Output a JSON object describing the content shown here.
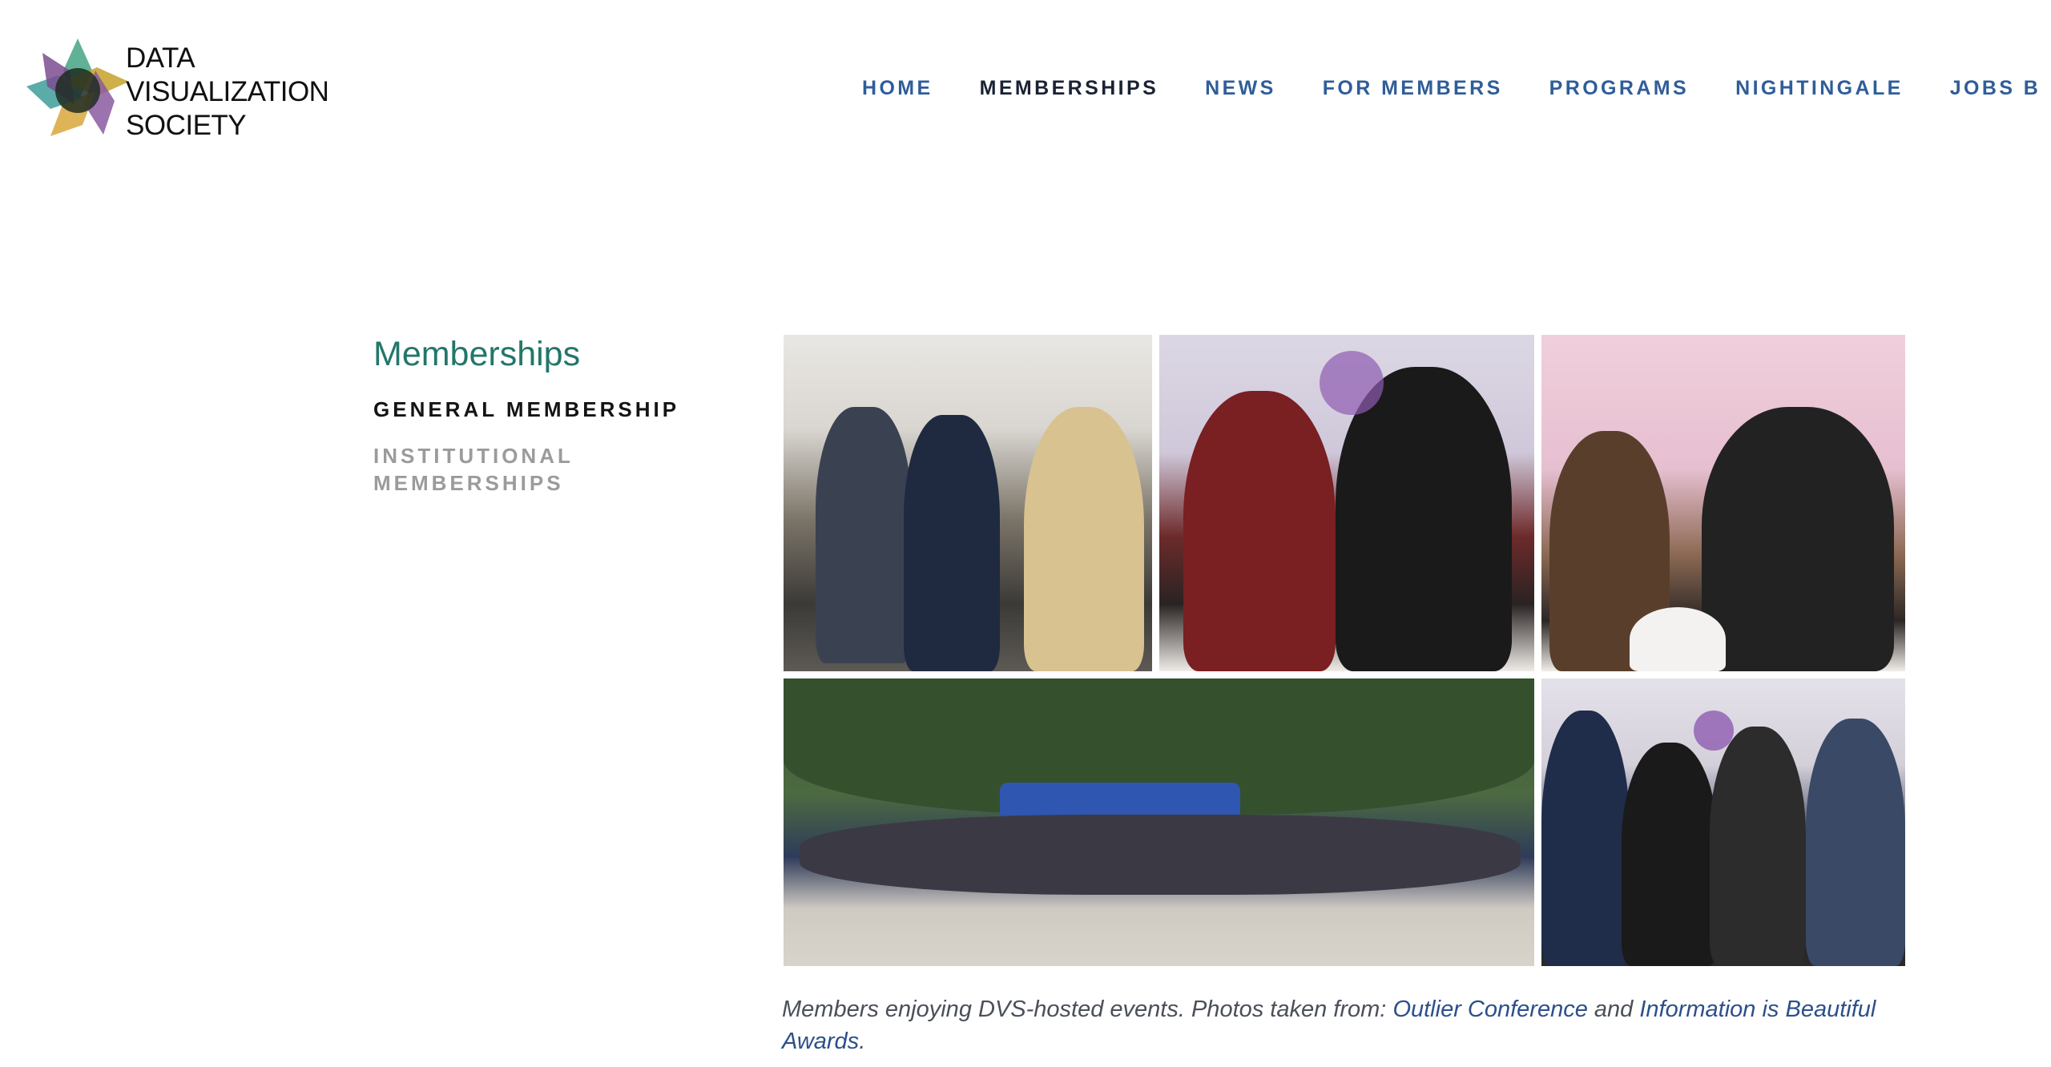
{
  "header": {
    "logo_lines": [
      "DATA",
      "VISUALIZATION",
      "SOCIETY"
    ],
    "nav": [
      {
        "label": "HOME",
        "active": false
      },
      {
        "label": "MEMBERSHIPS",
        "active": true
      },
      {
        "label": "NEWS",
        "active": false
      },
      {
        "label": "FOR MEMBERS",
        "active": false
      },
      {
        "label": "PROGRAMS",
        "active": false
      },
      {
        "label": "NIGHTINGALE",
        "active": false
      },
      {
        "label": "JOBS B",
        "active": false
      }
    ]
  },
  "sidebar": {
    "title": "Memberships",
    "items": [
      "GENERAL MEMBERSHIP",
      "INSTITUTIONAL MEMBERSHIPS"
    ]
  },
  "caption": {
    "prefix": "Members enjoying DVS-hosted events. Photos taken from: ",
    "link1": "Outlier Conference",
    "middle": " and ",
    "link2": "Information is Beautiful Awards",
    "suffix": "."
  },
  "colors": {
    "nav": "#2f5d9a",
    "nav_active": "#1a2233",
    "sidebar_title": "#23766a",
    "link": "#2c4f8a"
  }
}
